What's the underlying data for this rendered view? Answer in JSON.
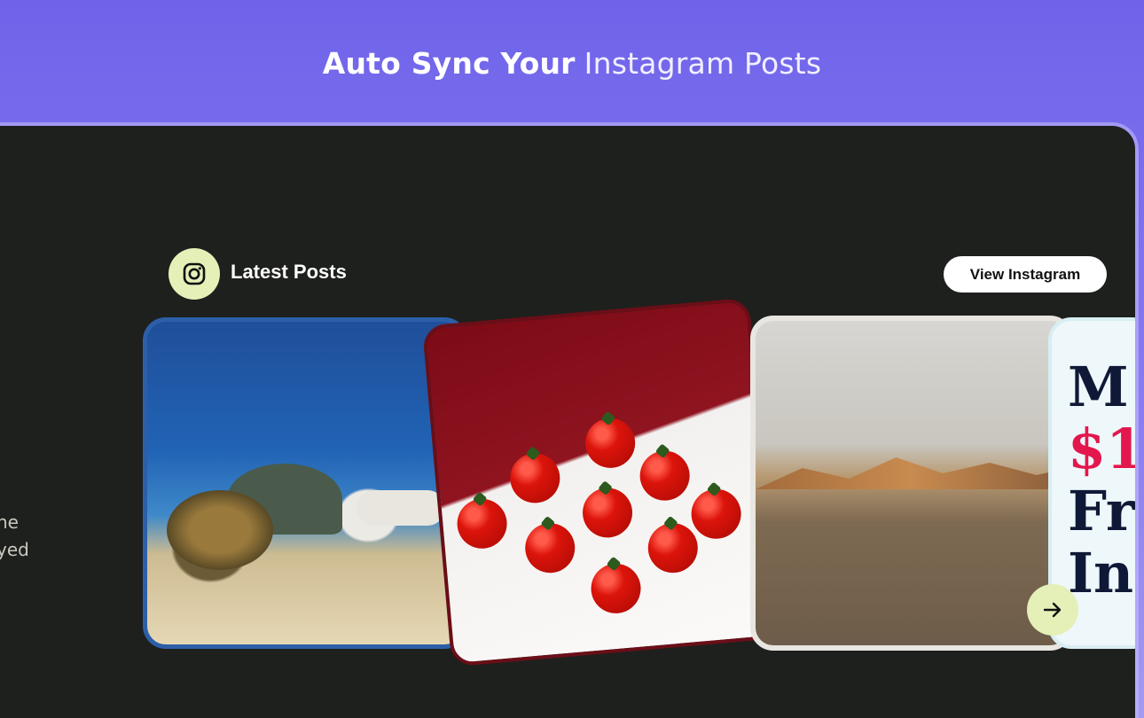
{
  "header": {
    "title_strong": "Auto Sync Your",
    "title_light": "Instagram Posts"
  },
  "side_text": {
    "line1": "he",
    "line2": "yed"
  },
  "feed": {
    "section_title": "Latest Posts",
    "view_button_label": "View Instagram",
    "icon": "instagram-icon",
    "next_icon": "arrow-right-icon",
    "cards": [
      {
        "image": "sea-turtle-and-diver"
      },
      {
        "image": "tomatoes-on-red"
      },
      {
        "image": "desert-mountains"
      },
      {
        "image": "promo-graphic",
        "text_line1": "M",
        "text_line2": "$1",
        "text_line3": "Fr",
        "text_line4": "In"
      }
    ]
  },
  "colors": {
    "accent_badge": "#e4f0b8",
    "panel_bg": "#1e201d",
    "header_gradient_start": "#6f63ea",
    "promo_red": "#e3174d"
  }
}
